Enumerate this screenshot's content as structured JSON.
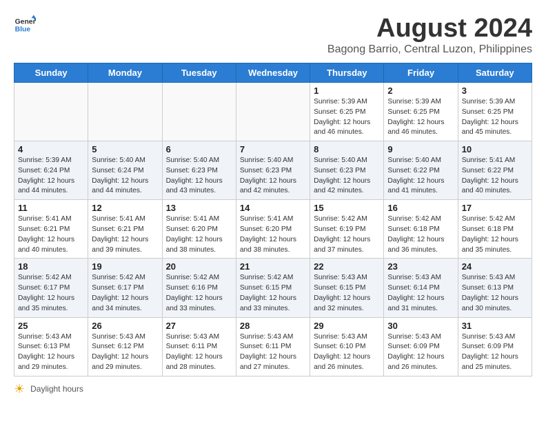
{
  "logo": {
    "line1": "General",
    "line2": "Blue"
  },
  "title": "August 2024",
  "location": "Bagong Barrio, Central Luzon, Philippines",
  "days_of_week": [
    "Sunday",
    "Monday",
    "Tuesday",
    "Wednesday",
    "Thursday",
    "Friday",
    "Saturday"
  ],
  "footer": {
    "icon": "☀",
    "label": "Daylight hours"
  },
  "weeks": [
    [
      {
        "day": "",
        "info": ""
      },
      {
        "day": "",
        "info": ""
      },
      {
        "day": "",
        "info": ""
      },
      {
        "day": "",
        "info": ""
      },
      {
        "day": "1",
        "info": "Sunrise: 5:39 AM\nSunset: 6:25 PM\nDaylight: 12 hours\nand 46 minutes."
      },
      {
        "day": "2",
        "info": "Sunrise: 5:39 AM\nSunset: 6:25 PM\nDaylight: 12 hours\nand 46 minutes."
      },
      {
        "day": "3",
        "info": "Sunrise: 5:39 AM\nSunset: 6:25 PM\nDaylight: 12 hours\nand 45 minutes."
      }
    ],
    [
      {
        "day": "4",
        "info": "Sunrise: 5:39 AM\nSunset: 6:24 PM\nDaylight: 12 hours\nand 44 minutes."
      },
      {
        "day": "5",
        "info": "Sunrise: 5:40 AM\nSunset: 6:24 PM\nDaylight: 12 hours\nand 44 minutes."
      },
      {
        "day": "6",
        "info": "Sunrise: 5:40 AM\nSunset: 6:23 PM\nDaylight: 12 hours\nand 43 minutes."
      },
      {
        "day": "7",
        "info": "Sunrise: 5:40 AM\nSunset: 6:23 PM\nDaylight: 12 hours\nand 42 minutes."
      },
      {
        "day": "8",
        "info": "Sunrise: 5:40 AM\nSunset: 6:23 PM\nDaylight: 12 hours\nand 42 minutes."
      },
      {
        "day": "9",
        "info": "Sunrise: 5:40 AM\nSunset: 6:22 PM\nDaylight: 12 hours\nand 41 minutes."
      },
      {
        "day": "10",
        "info": "Sunrise: 5:41 AM\nSunset: 6:22 PM\nDaylight: 12 hours\nand 40 minutes."
      }
    ],
    [
      {
        "day": "11",
        "info": "Sunrise: 5:41 AM\nSunset: 6:21 PM\nDaylight: 12 hours\nand 40 minutes."
      },
      {
        "day": "12",
        "info": "Sunrise: 5:41 AM\nSunset: 6:21 PM\nDaylight: 12 hours\nand 39 minutes."
      },
      {
        "day": "13",
        "info": "Sunrise: 5:41 AM\nSunset: 6:20 PM\nDaylight: 12 hours\nand 38 minutes."
      },
      {
        "day": "14",
        "info": "Sunrise: 5:41 AM\nSunset: 6:20 PM\nDaylight: 12 hours\nand 38 minutes."
      },
      {
        "day": "15",
        "info": "Sunrise: 5:42 AM\nSunset: 6:19 PM\nDaylight: 12 hours\nand 37 minutes."
      },
      {
        "day": "16",
        "info": "Sunrise: 5:42 AM\nSunset: 6:18 PM\nDaylight: 12 hours\nand 36 minutes."
      },
      {
        "day": "17",
        "info": "Sunrise: 5:42 AM\nSunset: 6:18 PM\nDaylight: 12 hours\nand 35 minutes."
      }
    ],
    [
      {
        "day": "18",
        "info": "Sunrise: 5:42 AM\nSunset: 6:17 PM\nDaylight: 12 hours\nand 35 minutes."
      },
      {
        "day": "19",
        "info": "Sunrise: 5:42 AM\nSunset: 6:17 PM\nDaylight: 12 hours\nand 34 minutes."
      },
      {
        "day": "20",
        "info": "Sunrise: 5:42 AM\nSunset: 6:16 PM\nDaylight: 12 hours\nand 33 minutes."
      },
      {
        "day": "21",
        "info": "Sunrise: 5:42 AM\nSunset: 6:15 PM\nDaylight: 12 hours\nand 33 minutes."
      },
      {
        "day": "22",
        "info": "Sunrise: 5:43 AM\nSunset: 6:15 PM\nDaylight: 12 hours\nand 32 minutes."
      },
      {
        "day": "23",
        "info": "Sunrise: 5:43 AM\nSunset: 6:14 PM\nDaylight: 12 hours\nand 31 minutes."
      },
      {
        "day": "24",
        "info": "Sunrise: 5:43 AM\nSunset: 6:13 PM\nDaylight: 12 hours\nand 30 minutes."
      }
    ],
    [
      {
        "day": "25",
        "info": "Sunrise: 5:43 AM\nSunset: 6:13 PM\nDaylight: 12 hours\nand 29 minutes."
      },
      {
        "day": "26",
        "info": "Sunrise: 5:43 AM\nSunset: 6:12 PM\nDaylight: 12 hours\nand 29 minutes."
      },
      {
        "day": "27",
        "info": "Sunrise: 5:43 AM\nSunset: 6:11 PM\nDaylight: 12 hours\nand 28 minutes."
      },
      {
        "day": "28",
        "info": "Sunrise: 5:43 AM\nSunset: 6:11 PM\nDaylight: 12 hours\nand 27 minutes."
      },
      {
        "day": "29",
        "info": "Sunrise: 5:43 AM\nSunset: 6:10 PM\nDaylight: 12 hours\nand 26 minutes."
      },
      {
        "day": "30",
        "info": "Sunrise: 5:43 AM\nSunset: 6:09 PM\nDaylight: 12 hours\nand 26 minutes."
      },
      {
        "day": "31",
        "info": "Sunrise: 5:43 AM\nSunset: 6:09 PM\nDaylight: 12 hours\nand 25 minutes."
      }
    ]
  ]
}
